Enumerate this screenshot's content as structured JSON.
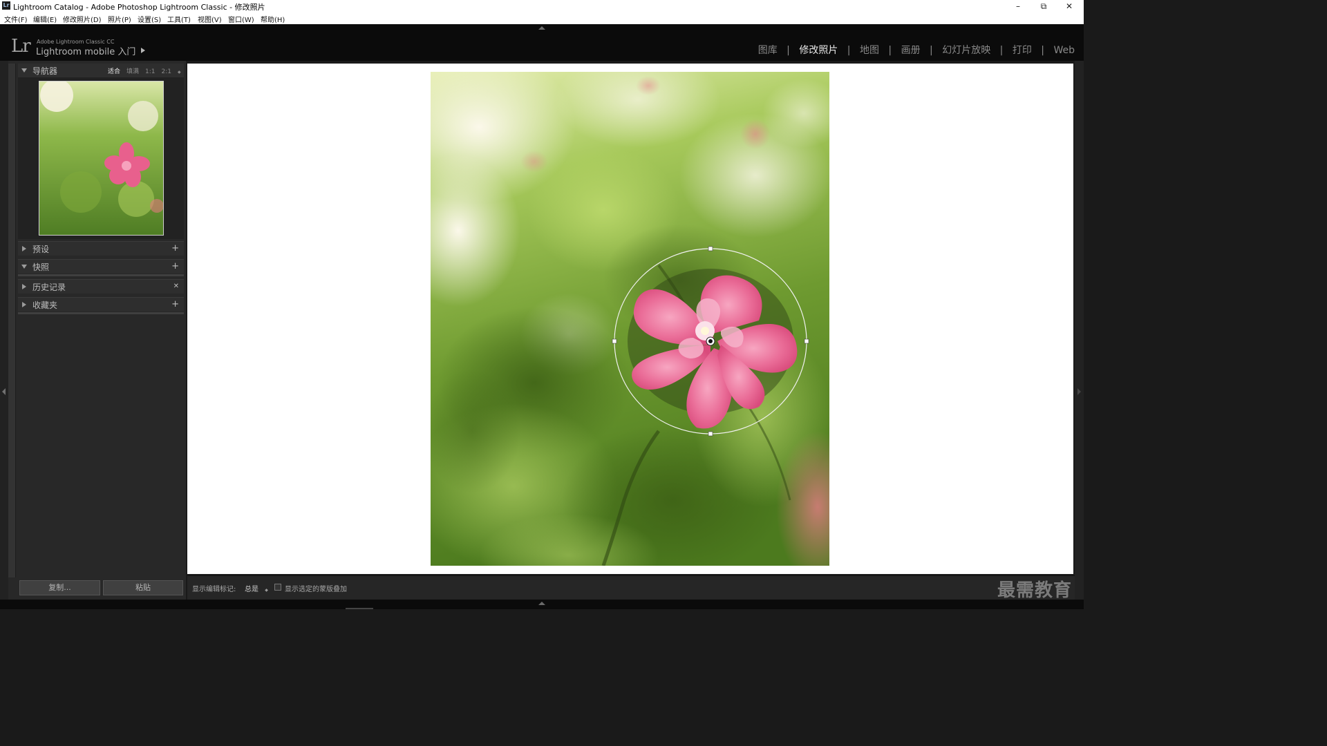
{
  "window": {
    "title": "Lightroom Catalog - Adobe Photoshop Lightroom Classic - 修改照片",
    "app_icon": "Lr",
    "controls": {
      "minimize": "–",
      "restore": "⧉",
      "close": "✕"
    }
  },
  "menu": [
    "文件(F)",
    "编辑(E)",
    "修改照片(D)",
    "照片(P)",
    "设置(S)",
    "工具(T)",
    "视图(V)",
    "窗口(W)",
    "帮助(H)"
  ],
  "brand": {
    "logo": "Lr",
    "small": "Adobe Lightroom Classic CC",
    "big": "Lightroom mobile 入门"
  },
  "modules": {
    "items": [
      "图库",
      "修改照片",
      "地图",
      "画册",
      "幻灯片放映",
      "打印",
      "Web"
    ],
    "separator": "|",
    "active": "修改照片"
  },
  "left_panel": {
    "navigator": {
      "title": "导航器",
      "zoom_options": [
        "适合",
        "填满",
        "1:1",
        "2:1"
      ],
      "zoom_arrows": "◆",
      "active_zoom": "适合"
    },
    "panels": [
      {
        "title": "预设",
        "action": "+",
        "expanded": false
      },
      {
        "title": "快照",
        "action": "+",
        "expanded": true
      },
      {
        "title": "历史记录",
        "action": "✕",
        "expanded": false
      },
      {
        "title": "收藏夹",
        "action": "+",
        "expanded": false
      }
    ],
    "buttons": {
      "copy": "复制...",
      "paste": "粘贴"
    }
  },
  "toolbar": {
    "show_edit_pins_label": "显示编辑标记:",
    "show_edit_pins_value": "总是",
    "select_arrows": "◆",
    "overlay_checkbox_label": "显示选定的蒙版叠加",
    "overlay_checked": false
  },
  "watermark": "最需教育",
  "colors": {
    "accent_active": "#e8e8e8",
    "inactive_text": "#8a8a8a",
    "panel_bg": "#282828",
    "canvas_bg": "#ffffff"
  }
}
